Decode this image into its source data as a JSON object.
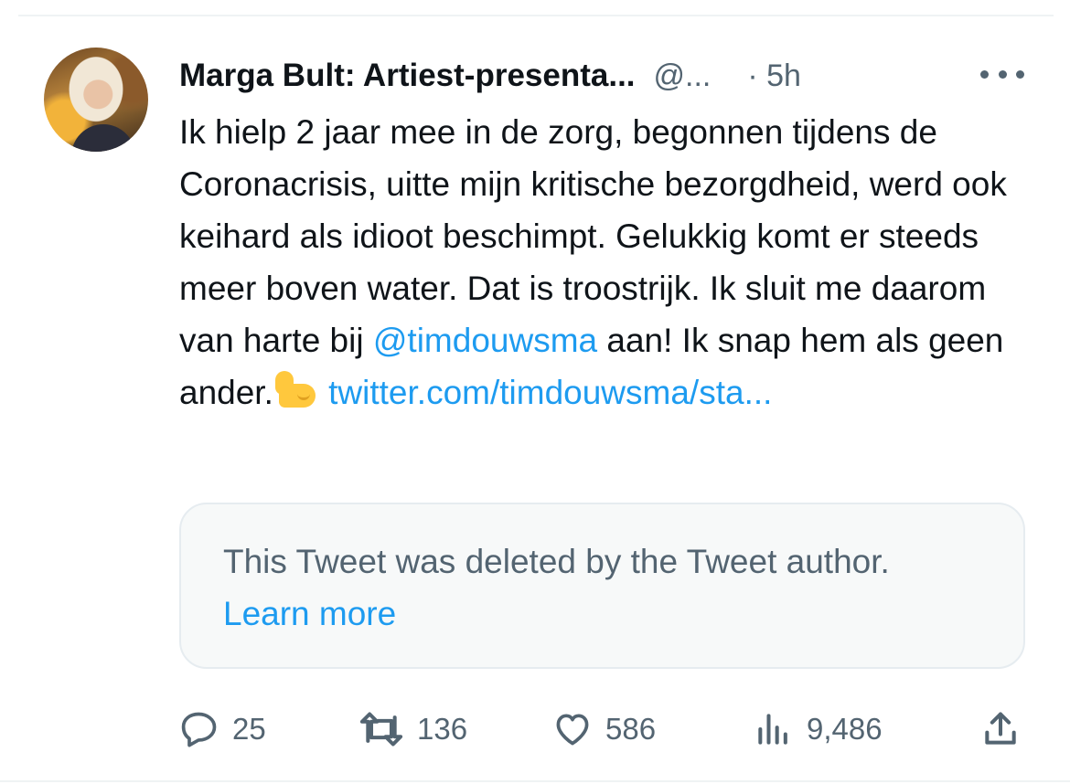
{
  "tweet": {
    "author": {
      "display_name": "Marga Bult: Artiest-presenta...",
      "handle": "@...",
      "time": "· 5h"
    },
    "text": {
      "part1": "Ik hielp 2 jaar mee in de zorg, begonnen tijdens de Coronacrisis, uitte mijn kritische bezorgdheid, werd ook keihard als idioot beschimpt. Gelukkig komt er steeds meer boven water. Dat is troostrijk. Ik sluit me daarom van harte bij ",
      "mention": "@timdouwsma",
      "part2": " aan! Ik snap hem als geen ander.",
      "emoji": "flexed-biceps",
      "link": "twitter.com/timdouwsma/sta..."
    },
    "quoted": {
      "message": "This Tweet was deleted by the Tweet author.",
      "learn_more": "Learn more"
    },
    "actions": {
      "replies": "25",
      "retweets": "136",
      "likes": "586",
      "views": "9,486"
    }
  },
  "colors": {
    "accent": "#1d9bf0",
    "secondary_text": "#536471",
    "primary_text": "#0f1419"
  }
}
